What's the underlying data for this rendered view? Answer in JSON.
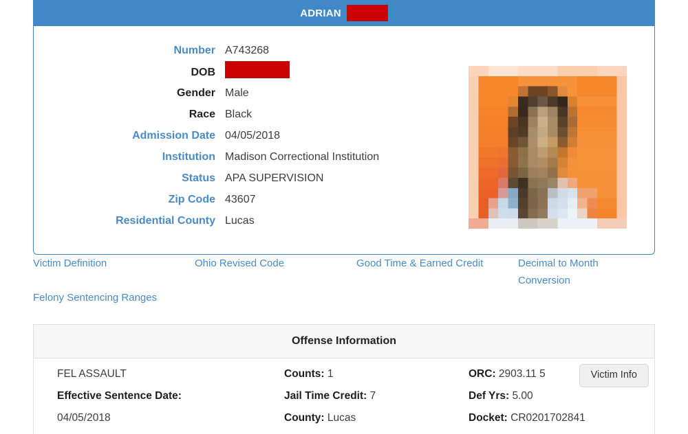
{
  "offender": {
    "header": {
      "name": "ADRIAN",
      "redacted_last_name": "",
      "redaction_color": "#cc0000",
      "header_color": "#4189c6"
    },
    "photo": {
      "alt": "offender-photo",
      "background_color": "#f58a2e"
    },
    "details": [
      {
        "label": "Number",
        "value": "A743268",
        "label_style": "blue",
        "redacted": false
      },
      {
        "label": "DOB",
        "value": "",
        "label_style": "dark",
        "redacted": true
      },
      {
        "label": "Gender",
        "value": "Male",
        "label_style": "dark",
        "redacted": false
      },
      {
        "label": "Race",
        "value": "Black",
        "label_style": "dark",
        "redacted": false
      },
      {
        "label": "Admission Date",
        "value": "04/05/2018",
        "label_style": "blue",
        "redacted": false
      },
      {
        "label": "Institution",
        "value": "Madison Correctional Institution",
        "label_style": "blue",
        "redacted": false
      },
      {
        "label": "Status",
        "value": "APA SUPERVISION",
        "label_style": "blue",
        "redacted": false
      },
      {
        "label": "Zip Code",
        "value": "43607",
        "label_style": "blue",
        "redacted": false
      },
      {
        "label": "Residential County",
        "value": "Lucas",
        "label_style": "blue",
        "redacted": false
      }
    ]
  },
  "resource_links": [
    {
      "label": "Victim Definition"
    },
    {
      "label": "Ohio Revised Code"
    },
    {
      "label": "Good Time & Earned Credit"
    },
    {
      "label": "Decimal to Month Conversion"
    },
    {
      "label": "Felony Sentencing Ranges"
    }
  ],
  "offense": {
    "section_title": "Offense Information",
    "victim_info_label": "Victim Info",
    "row": {
      "offense_name": "FEL ASSAULT",
      "counts_label": "Counts:",
      "counts_value": "1",
      "orc_label": "ORC:",
      "orc_value": "2903.11 5",
      "effective_sentence_date_label": "Effective Sentence Date:",
      "effective_sentence_date_value": "04/05/2018",
      "jail_time_credit_label": "Jail Time Credit:",
      "jail_time_credit_value": "7",
      "county_label": "County:",
      "county_value": "Lucas",
      "def_yrs_label": "Def Yrs:",
      "def_yrs_value": "5.00",
      "docket_label": "Docket:",
      "docket_value": "CR0201702841"
    }
  },
  "theme": {
    "accent_blue": "#4a8ac4",
    "header_blue": "#4189c6",
    "redaction_red": "#cc0000",
    "panel_gray": "#f6f6f6"
  }
}
